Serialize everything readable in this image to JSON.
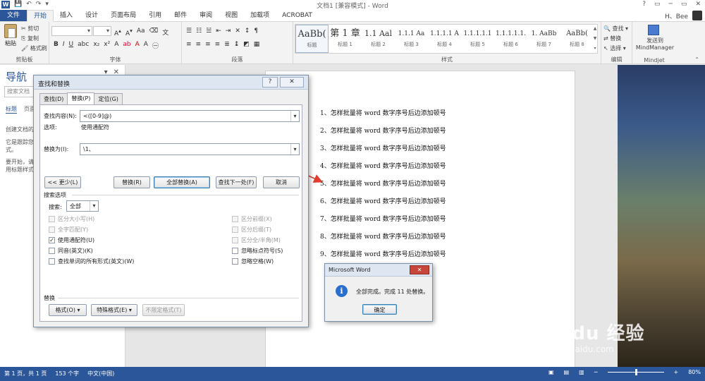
{
  "window": {
    "title": "文档1 [兼容模式] - Word",
    "controls": [
      "?",
      "▭",
      "─",
      "▭",
      "✕"
    ]
  },
  "qat": {
    "logo": "W",
    "save": "💾",
    "undo": "↶",
    "redo": "↷",
    "more": "▾"
  },
  "ribbon": {
    "tabs": [
      "文件",
      "开始",
      "插入",
      "设计",
      "页面布局",
      "引用",
      "邮件",
      "审阅",
      "视图",
      "加载项",
      "ACROBAT"
    ],
    "active_tab": "开始",
    "user": "H、Bee",
    "clipboard": {
      "paste": "粘贴",
      "cut": "剪切",
      "copy": "复制",
      "format_painter": "格式刷",
      "label": "剪贴板"
    },
    "font": {
      "label": "字体",
      "font_size_label": "Aa"
    },
    "paragraph": {
      "label": "段落"
    },
    "styles": {
      "label": "样式",
      "items": [
        {
          "preview": "AaBb(",
          "name": "标题"
        },
        {
          "preview": "第 1 章",
          "name": "标题 1"
        },
        {
          "preview": "1.1  Aal",
          "name": "标题 2"
        },
        {
          "preview": "1.1.1  Aa",
          "name": "标题 3"
        },
        {
          "preview": "1.1.1.1  A",
          "name": "标题 4"
        },
        {
          "preview": "1.1.1.1.1",
          "name": "标题 5"
        },
        {
          "preview": "1.1.1.1.1.",
          "name": "标题 6"
        },
        {
          "preview": "1.  AaBb",
          "name": "标题 7"
        },
        {
          "preview": "AaBb(",
          "name": "标题 8"
        }
      ]
    },
    "editing": {
      "find": "查找",
      "replace": "替换",
      "select": "选择",
      "label": "编辑"
    },
    "mindjet": {
      "send": "发送到",
      "target": "MindManager",
      "label": "Mindjet"
    }
  },
  "nav": {
    "title": "导航",
    "search_placeholder": "搜索文档",
    "tabs": [
      "标题",
      "页面"
    ],
    "text1": "创建文档的交互式",
    "text2": "它是跟踪您所在的位置或快速移动内容的好方式。",
    "text3": "要开始，请转到\"开始\"选项卡，然后向标题应用标题样式。"
  },
  "document": {
    "lines": [
      "1、怎样批量将 word 数字序号后边添加顿号",
      "2、怎样批量将 word 数字序号后边添加顿号",
      "3、怎样批量将 word 数字序号后边添加顿号",
      "4、怎样批量将 word 数字序号后边添加顿号",
      "5、怎样批量将 word 数字序号后边添加顿号",
      "6、怎样批量将 word 数字序号后边添加顿号",
      "7、怎样批量将 word 数字序号后边添加顿号",
      "8、怎样批量将 word 数字序号后边添加顿号",
      "9、怎样批量将 word 数字序号后边添加顿号"
    ]
  },
  "find_replace": {
    "title": "查找和替换",
    "help": "?",
    "close": "✕",
    "tabs": [
      "查找(D)",
      "替换(P)",
      "定位(G)"
    ],
    "active_tab": "替换(P)",
    "find_label": "查找内容(N):",
    "find_value": "<([0-9]@)",
    "options_label": "选项:",
    "options_value": "使用通配符",
    "replace_label": "替换为(I):",
    "replace_value": "\\1、",
    "buttons": {
      "less": "<< 更少(L)",
      "replace": "替换(R)",
      "replace_all": "全部替换(A)",
      "find_next": "查找下一处(F)",
      "cancel": "取消"
    },
    "search_options": "搜索选项",
    "search_label": "搜索:",
    "search_value": "全部",
    "checks_left": [
      {
        "label": "区分大小写(H)",
        "checked": false,
        "enabled": false
      },
      {
        "label": "全字匹配(Y)",
        "checked": false,
        "enabled": false
      },
      {
        "label": "使用通配符(U)",
        "checked": true,
        "enabled": true
      },
      {
        "label": "同音(英文)(K)",
        "checked": false,
        "enabled": true
      },
      {
        "label": "查找单词的所有形式(英文)(W)",
        "checked": false,
        "enabled": true
      }
    ],
    "checks_right": [
      {
        "label": "区分前缀(X)",
        "checked": false,
        "enabled": false
      },
      {
        "label": "区分后缀(T)",
        "checked": false,
        "enabled": false
      },
      {
        "label": "区分全/半角(M)",
        "checked": false,
        "enabled": false
      },
      {
        "label": "忽略标点符号(S)",
        "checked": false,
        "enabled": true
      },
      {
        "label": "忽略空格(W)",
        "checked": false,
        "enabled": true
      }
    ],
    "replace_section": "替换",
    "format_btn": "格式(O) ▾",
    "special_btn": "特殊格式(E) ▾",
    "no_format_btn": "不限定格式(T)"
  },
  "message_box": {
    "title": "Microsoft Word",
    "close": "✕",
    "icon": "i",
    "text": "全部完成。完成 11 处替换。",
    "ok": "确定"
  },
  "status_bar": {
    "page": "第 1 页，共 1 页",
    "words": "153 个字",
    "lang": "中文(中国)",
    "zoom": "80%",
    "zoom_minus": "─",
    "zoom_plus": "+",
    "zoom_fraction": 0.5
  },
  "watermark": {
    "brand": "Bai du 经验",
    "url": "jingyan.baidu.com"
  }
}
